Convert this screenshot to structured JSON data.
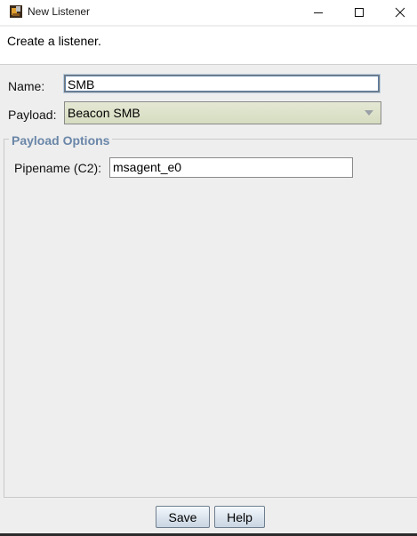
{
  "window": {
    "title": "New Listener",
    "controls": {
      "minimize_icon": "minimize-icon",
      "maximize_icon": "maximize-icon",
      "close_icon": "close-icon"
    }
  },
  "description": "Create a listener.",
  "form": {
    "name_label": "Name:",
    "name_value": "SMB",
    "payload_label": "Payload:",
    "payload_value": "Beacon SMB"
  },
  "payload_options": {
    "title": "Payload Options",
    "pipename_label": "Pipename (C2):",
    "pipename_value": "msagent_e0"
  },
  "buttons": {
    "save": "Save",
    "help": "Help"
  },
  "colors": {
    "accent": "#6a86a8",
    "select_bg": "#dde2c8"
  }
}
